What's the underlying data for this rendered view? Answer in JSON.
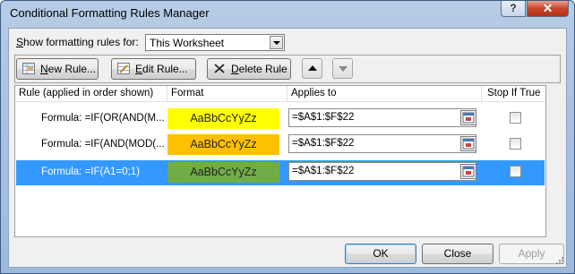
{
  "window": {
    "title": "Conditional Formatting Rules Manager",
    "help_glyph": "?",
    "close_glyph": "✕"
  },
  "show_rules": {
    "label_pre": "",
    "label_accel": "S",
    "label_post": "how formatting rules for:",
    "selected": "This Worksheet"
  },
  "toolbar": {
    "new_rule": {
      "accel": "N",
      "rest": "ew Rule..."
    },
    "edit_rule": {
      "accel": "E",
      "rest": "dit Rule..."
    },
    "delete_rule": {
      "accel": "D",
      "rest": "elete Rule"
    }
  },
  "grid": {
    "headers": {
      "rule": "Rule (applied in order shown)",
      "format": "Format",
      "applies_to": "Applies to",
      "stop_if_true": "Stop If True"
    },
    "rows": [
      {
        "formula": "Formula: =IF(OR(AND(M...",
        "sample": "AaBbCcYyZz",
        "format_color": "#ffff00",
        "applies_to": "=$A$1:$F$22",
        "stop_if_true": false,
        "selected": false
      },
      {
        "formula": "Formula: =IF(AND(MOD(...",
        "sample": "AaBbCcYyZz",
        "format_color": "#ffc000",
        "applies_to": "=$A$1:$F$22",
        "stop_if_true": false,
        "selected": false
      },
      {
        "formula": "Formula: =IF(A1=0;1)",
        "sample": "AaBbCcYyZz",
        "format_color": "#70ad47",
        "applies_to": "=$A$1:$F$22",
        "stop_if_true": false,
        "selected": true
      }
    ]
  },
  "footer": {
    "ok": "OK",
    "close": "Close",
    "apply": "Apply"
  },
  "colors": {
    "selection": "#3399ff",
    "title_bar": "#b7cde6",
    "dialog_bg": "#f0f0f0"
  }
}
